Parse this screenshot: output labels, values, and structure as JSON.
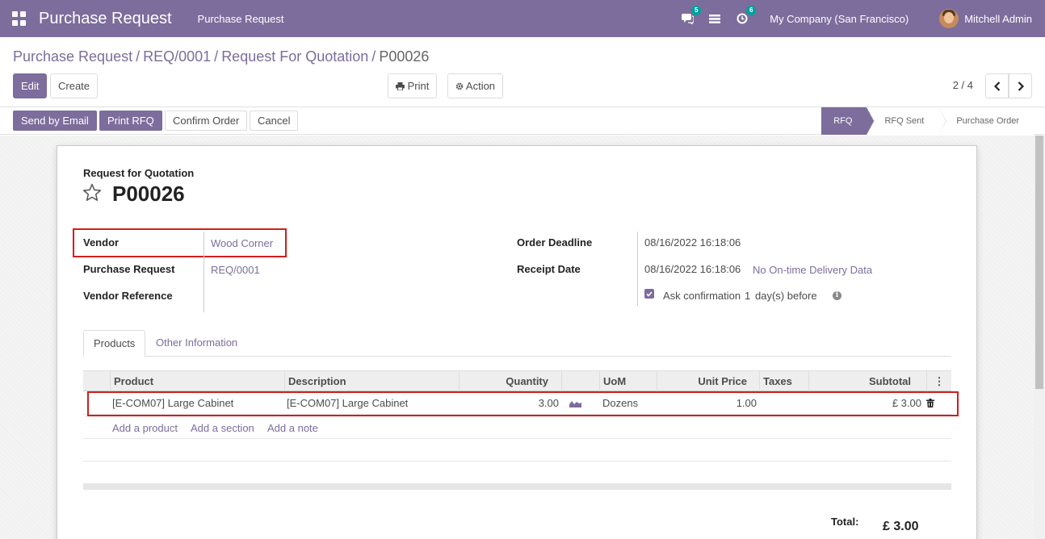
{
  "navbar": {
    "brand": "Purchase Request",
    "menu_item": "Purchase Request",
    "messages_badge": "5",
    "activities_badge": "6",
    "company": "My Company (San Francisco)",
    "user": "Mitchell Admin"
  },
  "breadcrumb": {
    "items": [
      "Purchase Request",
      "REQ/0001",
      "Request For Quotation"
    ],
    "current": "P00026"
  },
  "toolbar": {
    "edit_label": "Edit",
    "create_label": "Create",
    "print_label": "Print",
    "action_label": "Action",
    "pager": "2 / 4"
  },
  "statusbar": {
    "send_email_label": "Send by Email",
    "print_rfq_label": "Print RFQ",
    "confirm_label": "Confirm Order",
    "cancel_label": "Cancel",
    "stages": [
      "RFQ",
      "RFQ Sent",
      "Purchase Order"
    ],
    "active_stage": "RFQ"
  },
  "form": {
    "doc_label": "Request for Quotation",
    "doc_name": "P00026",
    "vendor_label": "Vendor",
    "vendor_value": "Wood Corner",
    "purchase_request_label": "Purchase Request",
    "purchase_request_value": "REQ/0001",
    "vendor_reference_label": "Vendor Reference",
    "order_deadline_label": "Order Deadline",
    "order_deadline_value": "08/16/2022 16:18:06",
    "receipt_date_label": "Receipt Date",
    "receipt_date_value": "08/16/2022 16:18:06",
    "delivery_link": "No On-time Delivery Data",
    "ask_confirmation_label": "Ask confirmation",
    "ask_confirmation_days": "1",
    "ask_confirmation_suffix": "day(s) before"
  },
  "tabs": [
    "Products",
    "Other Information"
  ],
  "table": {
    "columns": [
      "Product",
      "Description",
      "Quantity",
      "UoM",
      "Unit Price",
      "Taxes",
      "Subtotal"
    ],
    "rows": [
      {
        "product": "[E-COM07] Large Cabinet",
        "description": "[E-COM07] Large Cabinet",
        "quantity": "3.00",
        "uom": "Dozens",
        "unit_price": "1.00",
        "taxes": "",
        "subtotal": "£ 3.00"
      }
    ],
    "add_product": "Add a product",
    "add_section": "Add a section",
    "add_note": "Add a note"
  },
  "totals": {
    "label": "Total:",
    "value": "£ 3.00"
  },
  "colors": {
    "brand": "#7c6d9c",
    "highlight": "#d31d1d",
    "badge": "#00a09d"
  }
}
